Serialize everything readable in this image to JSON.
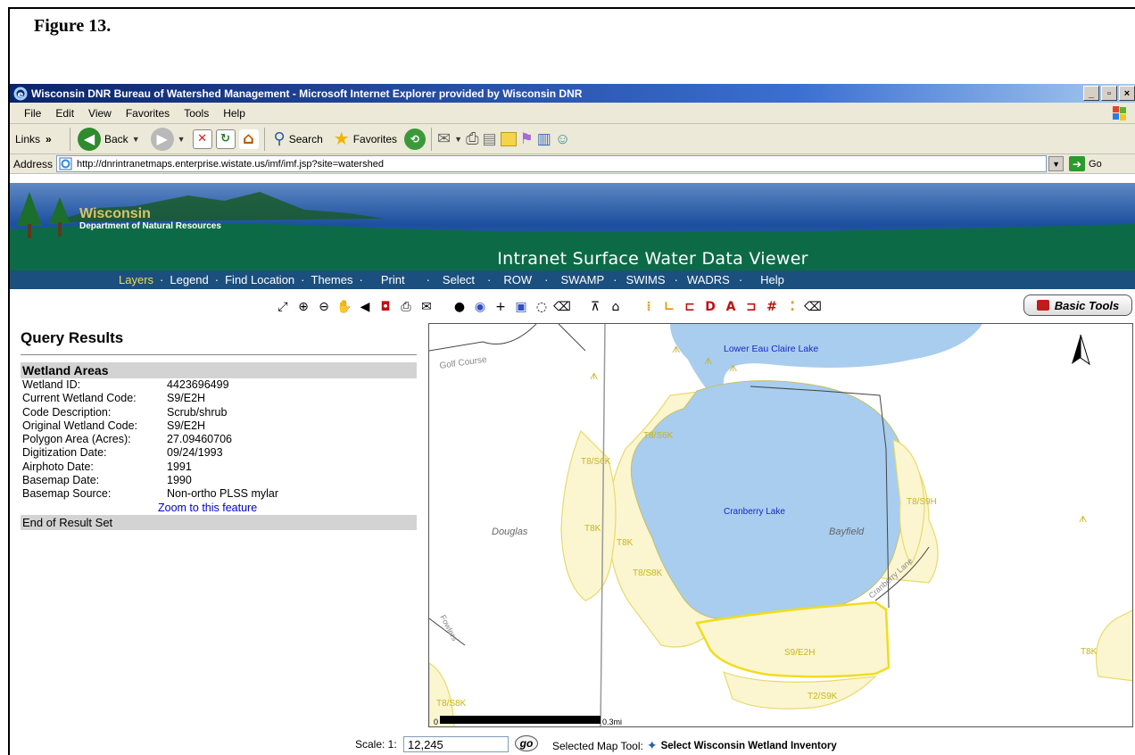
{
  "figure_title": "Figure 13.",
  "window": {
    "title": "Wisconsin DNR Bureau of Watershed Management - Microsoft Internet Explorer provided by Wisconsin DNR",
    "minimize": "_",
    "maximize": "▫",
    "close": "×"
  },
  "menu": [
    "File",
    "Edit",
    "View",
    "Favorites",
    "Tools",
    "Help"
  ],
  "toolbar": {
    "links": "Links",
    "links_chevron": "»",
    "back": "Back",
    "search": "Search",
    "favorites": "Favorites"
  },
  "address": {
    "label": "Address",
    "url": "http://dnrintranetmaps.enterprise.wistate.us/imf/imf.jsp?site=watershed",
    "go": "Go"
  },
  "banner": {
    "name": "Wisconsin",
    "dept": "Department of Natural Resources",
    "app_title": "Intranet Surface Water Data Viewer"
  },
  "nav": [
    "Layers",
    "Legend",
    "Find Location",
    "Themes",
    "Print",
    "Select",
    "ROW",
    "SWAMP",
    "SWIMS",
    "WADRS",
    "Help"
  ],
  "basic_tools": "Basic Tools",
  "results": {
    "title": "Query Results",
    "section": "Wetland Areas",
    "rows": [
      {
        "k": "Wetland ID:",
        "v": "4423696499"
      },
      {
        "k": "Current Wetland Code:",
        "v": "S9/E2H"
      },
      {
        "k": "Code Description:",
        "v": "Scrub/shrub"
      },
      {
        "k": "Original Wetland Code:",
        "v": "S9/E2H"
      },
      {
        "k": "Polygon Area (Acres):",
        "v": "27.09460706"
      },
      {
        "k": "Digitization Date:",
        "v": "09/24/1993"
      },
      {
        "k": "Airphoto Date:",
        "v": "1991"
      },
      {
        "k": "Basemap Date:",
        "v": "1990"
      },
      {
        "k": "Basemap Source:",
        "v": "Non-ortho PLSS mylar"
      }
    ],
    "zoom_link": "Zoom to this feature",
    "end": "End of Result Set"
  },
  "map": {
    "labels": {
      "lower_lake": "Lower Eau Claire Lake",
      "cranberry": "Cranberry Lake",
      "douglas": "Douglas",
      "bayfield": "Bayfield",
      "golf": "Golf Course",
      "fowlers": "Fowlers",
      "cranberry_lane": "Cranberry Lane",
      "s9e2h": "S9/E2H",
      "t2s9k": "T2/S9K",
      "t8s6k_top": "T8/S6K",
      "t8s6k_left": "T8/S6K",
      "t8k_a": "T8K",
      "t8k_b": "T8K",
      "t8s8k_mid": "T8/S8K",
      "t8s8k_bottom": "T8/S8K",
      "t8s9h": "T8/S9H",
      "t8k_right": "T8K",
      "scale_zero": "0",
      "scale_end": "0.3mi"
    }
  },
  "scale": {
    "label": "Scale: 1:",
    "value": "12,245",
    "go": "go",
    "selected_label": "Selected Map Tool:",
    "selected_tool": "Select Wisconsin Wetland Inventory"
  }
}
